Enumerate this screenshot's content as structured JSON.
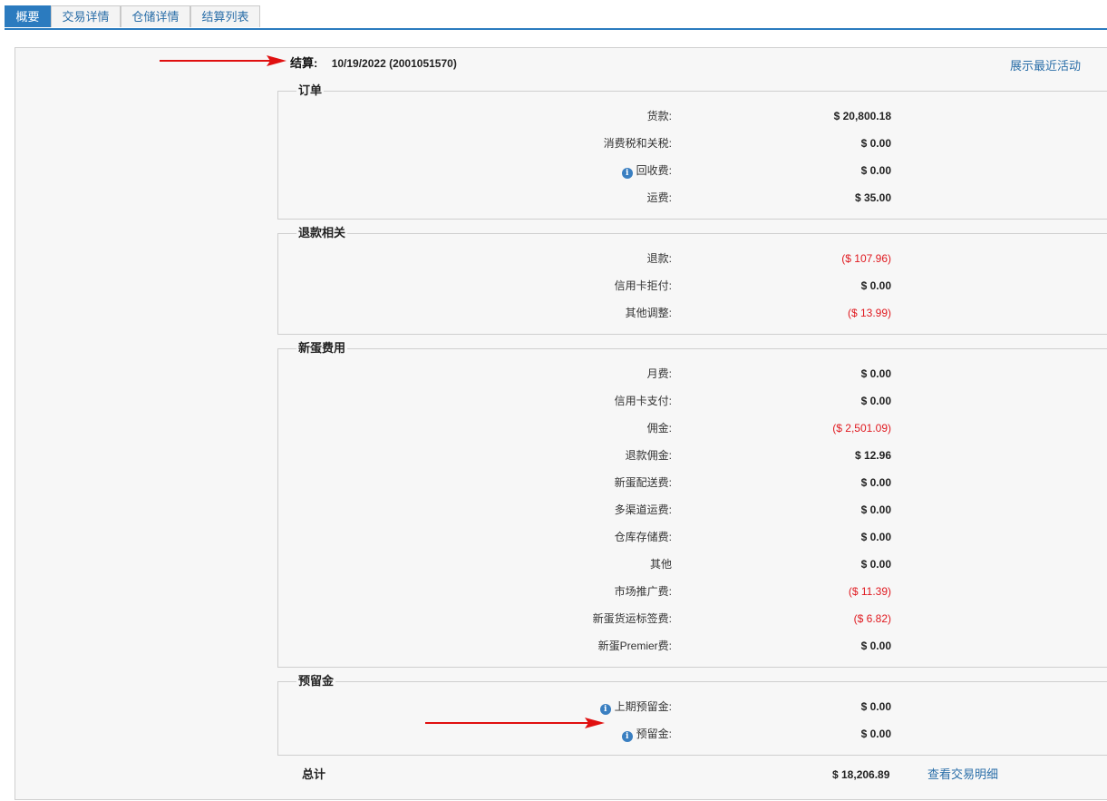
{
  "tabs": [
    {
      "label": "概要",
      "active": true
    },
    {
      "label": "交易详情",
      "active": false
    },
    {
      "label": "仓储详情",
      "active": false
    },
    {
      "label": "结算列表",
      "active": false
    }
  ],
  "settlement": {
    "label": "结算:",
    "value": "10/19/2022 (2001051570)"
  },
  "recent_activity_link": "展示最近活动",
  "sections": {
    "orders": {
      "title": "订单",
      "rows": [
        {
          "label": "货款:",
          "value": "$ 20,800.18"
        },
        {
          "label": "消费税和关税:",
          "value": "$ 0.00"
        },
        {
          "label": "回收费:",
          "value": "$ 0.00"
        },
        {
          "label": "运费:",
          "value": "$ 35.00"
        }
      ]
    },
    "refunds": {
      "title": "退款相关",
      "rows": [
        {
          "label": "退款:",
          "value": "($ 107.96)"
        },
        {
          "label": "信用卡拒付:",
          "value": "$ 0.00"
        },
        {
          "label": "其他调整:",
          "value": "($ 13.99)"
        }
      ]
    },
    "fees": {
      "title": "新蛋费用",
      "rows": [
        {
          "label": "月费:",
          "value": "$ 0.00"
        },
        {
          "label": "信用卡支付:",
          "value": "$ 0.00"
        },
        {
          "label": "佣金:",
          "value": "($ 2,501.09)"
        },
        {
          "label": "退款佣金:",
          "value": "$ 12.96"
        },
        {
          "label": "新蛋配送费:",
          "value": "$ 0.00"
        },
        {
          "label": "多渠道运费:",
          "value": "$ 0.00"
        },
        {
          "label": "仓库存储费:",
          "value": "$ 0.00"
        },
        {
          "label": "其他",
          "value": "$ 0.00"
        },
        {
          "label": "市场推广费:",
          "value": "($ 11.39)"
        },
        {
          "label": "新蛋货运标签费:",
          "value": "($ 6.82)"
        },
        {
          "label": "新蛋Premier费:",
          "value": "$ 0.00"
        }
      ]
    },
    "reserve": {
      "title": "预留金",
      "rows": [
        {
          "label": "上期预留金:",
          "value": "$ 0.00"
        },
        {
          "label": "预留金:",
          "value": "$ 0.00"
        }
      ]
    }
  },
  "total": {
    "label": "总计",
    "value": "$ 18,206.89",
    "link": "查看交易明细"
  },
  "colors": {
    "accent": "#2b7bbf",
    "negative": "#e0191f",
    "arrow": "#e01010",
    "link": "#2a6ea8"
  },
  "icons": {
    "info": "info-circle-icon",
    "arrow": "red-arrow-icon"
  }
}
